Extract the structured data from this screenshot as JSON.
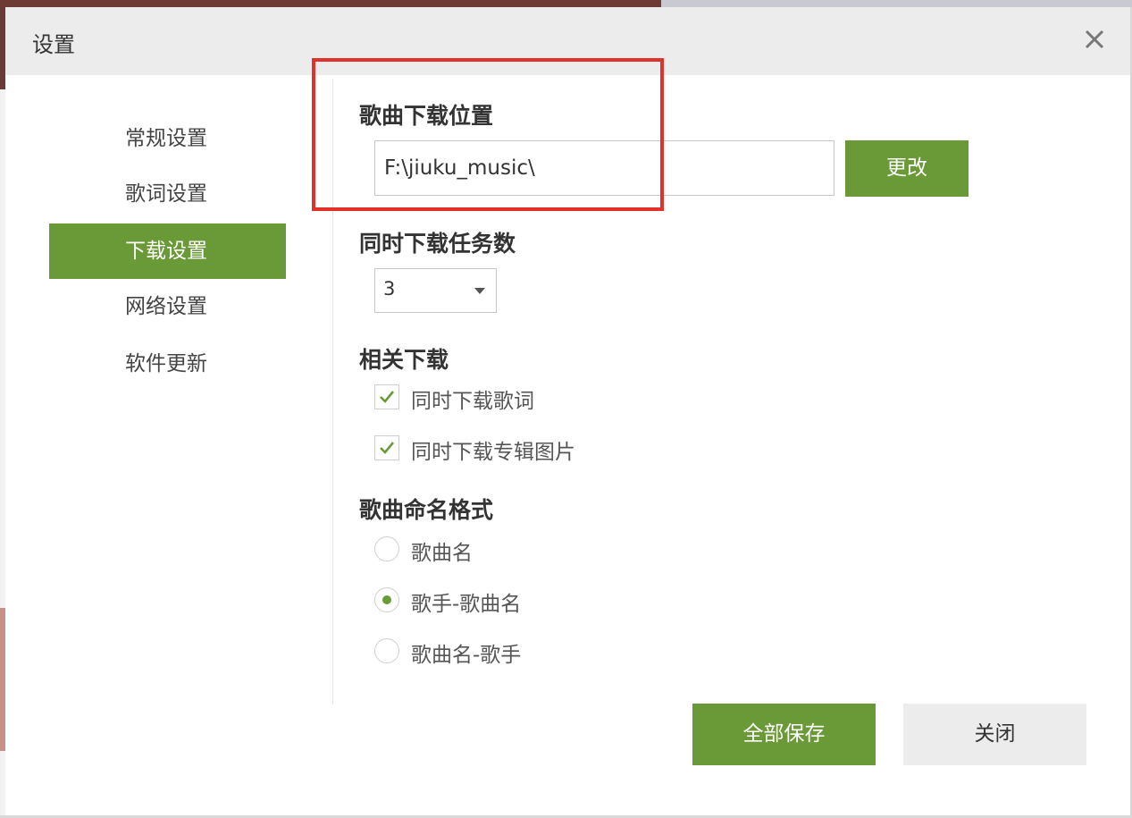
{
  "dialog": {
    "title": "设置"
  },
  "colors": {
    "accent": "#6a9a37",
    "highlight": "#e0312b"
  },
  "sidebar": {
    "items": [
      {
        "label": "常规设置"
      },
      {
        "label": "歌词设置"
      },
      {
        "label": "下载设置"
      },
      {
        "label": "网络设置"
      },
      {
        "label": "软件更新"
      }
    ],
    "active": "下载设置"
  },
  "download_location": {
    "title": "歌曲下载位置",
    "path": "F:\\jiuku_music\\",
    "change_label": "更改"
  },
  "concurrent": {
    "title": "同时下载任务数",
    "value": "3"
  },
  "related": {
    "title": "相关下载",
    "options": [
      {
        "label": "同时下载歌词",
        "checked": true
      },
      {
        "label": "同时下载专辑图片",
        "checked": true
      }
    ]
  },
  "naming": {
    "title": "歌曲命名格式",
    "options": [
      {
        "label": "歌曲名",
        "selected": false
      },
      {
        "label": "歌手-歌曲名",
        "selected": true
      },
      {
        "label": "歌曲名-歌手",
        "selected": false
      }
    ]
  },
  "footer": {
    "save_all_label": "全部保存",
    "close_label": "关闭"
  },
  "icons": {
    "close": "close-icon",
    "checkmark": "checkmark-icon",
    "dropdown": "chevron-down-icon"
  }
}
